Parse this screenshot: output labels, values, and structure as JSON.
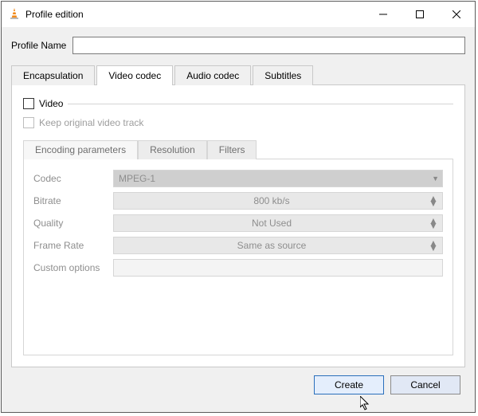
{
  "window": {
    "title": "Profile edition"
  },
  "profile": {
    "label": "Profile Name",
    "value": ""
  },
  "tabs": {
    "encapsulation": "Encapsulation",
    "video_codec": "Video codec",
    "audio_codec": "Audio codec",
    "subtitles": "Subtitles"
  },
  "video": {
    "video_chk_label": "Video",
    "keep_original_label": "Keep original video track",
    "subtabs": {
      "encoding": "Encoding parameters",
      "resolution": "Resolution",
      "filters": "Filters"
    },
    "fields": {
      "codec_label": "Codec",
      "codec_value": "MPEG-1",
      "bitrate_label": "Bitrate",
      "bitrate_value": "800 kb/s",
      "quality_label": "Quality",
      "quality_value": "Not Used",
      "framerate_label": "Frame Rate",
      "framerate_value": "Same as source",
      "custom_label": "Custom options"
    }
  },
  "buttons": {
    "create": "Create",
    "cancel": "Cancel"
  }
}
